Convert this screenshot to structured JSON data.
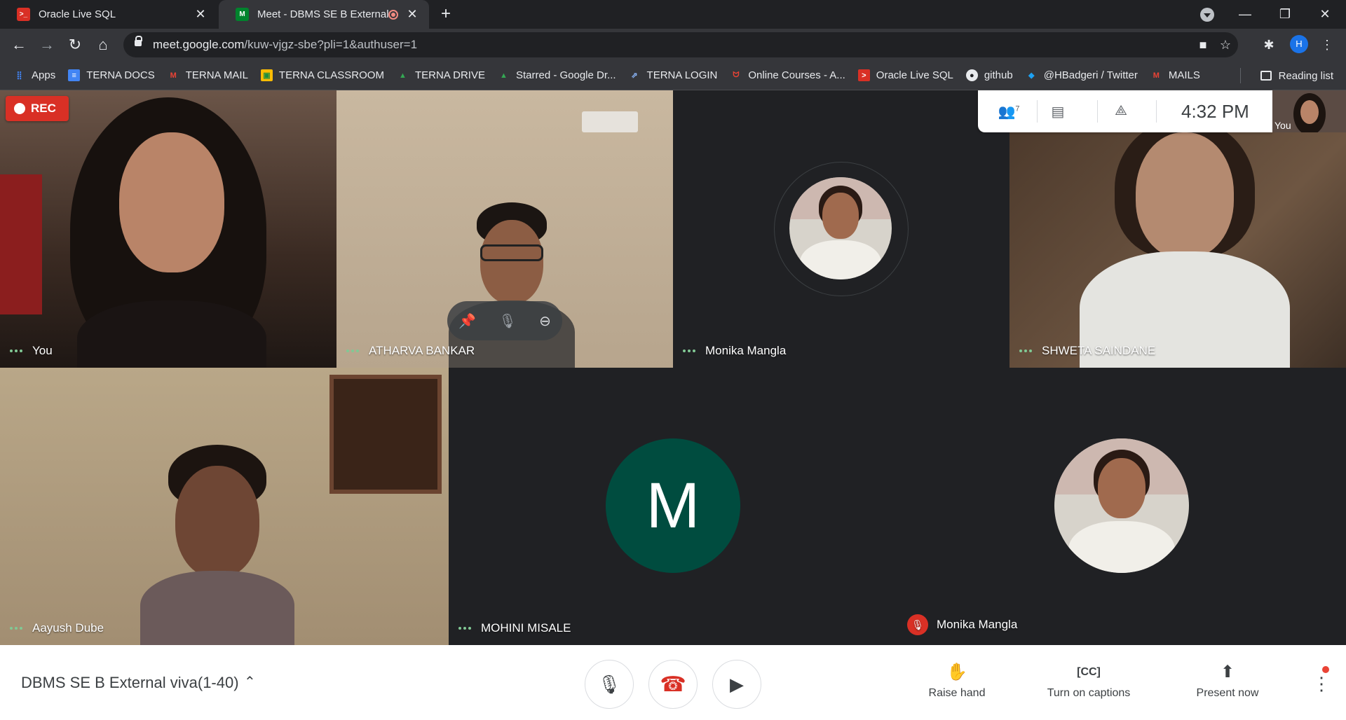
{
  "browser": {
    "tabs": [
      {
        "title": "Oracle Live SQL",
        "favicon": ">_",
        "favicon_color": "#d93025"
      },
      {
        "title": "Meet - DBMS SE B External v",
        "favicon": "M",
        "favicon_color": "#00832d",
        "active": true
      }
    ],
    "url_host": "meet.google.com",
    "url_path": "/kuw-vjgz-sbe?pli=1&authuser=1",
    "profile_initial": "H",
    "bookmarks": [
      {
        "label": "Apps",
        "icon": "apps-grid-icon",
        "color": "#4285f4"
      },
      {
        "label": "TERNA DOCS",
        "icon": "docs-icon",
        "color": "#4285f4"
      },
      {
        "label": "TERNA MAIL",
        "icon": "gmail-icon",
        "color": "#ea4335"
      },
      {
        "label": "TERNA CLASSROOM",
        "icon": "classroom-icon",
        "color": "#fbbc04"
      },
      {
        "label": "TERNA DRIVE",
        "icon": "drive-icon",
        "color": "#34a853"
      },
      {
        "label": "Starred - Google Dr...",
        "icon": "drive-icon",
        "color": "#34a853"
      },
      {
        "label": "TERNA LOGIN",
        "icon": "external-link-icon",
        "color": "#8ab4f8"
      },
      {
        "label": "Online Courses - A...",
        "icon": "courses-icon",
        "color": "#ea4335"
      },
      {
        "label": "Oracle Live SQL",
        "icon": "oracle-icon",
        "color": "#d93025"
      },
      {
        "label": "github",
        "icon": "github-icon",
        "color": "#e8eaed"
      },
      {
        "label": "@HBadgeri / Twitter",
        "icon": "twitter-icon",
        "color": "#1da1f2"
      },
      {
        "label": "MAILS",
        "icon": "gmail-icon",
        "color": "#ea4335"
      }
    ],
    "reading_list": "Reading list"
  },
  "meet": {
    "rec_label": "REC",
    "participants": [
      {
        "name": "You"
      },
      {
        "name": "ATHARVA BANKAR"
      },
      {
        "name": "Monika Mangla"
      },
      {
        "name": "SHWETA SAINDANE"
      },
      {
        "name": "Aayush Dube"
      },
      {
        "name": "MOHINI MISALE",
        "avatar_letter": "M"
      },
      {
        "name": "Monika Mangla",
        "muted": true
      }
    ],
    "participant_count": "7",
    "clock": "4:32  PM",
    "self_view_label": "You"
  },
  "bottom": {
    "meeting_title": "DBMS SE B External viva(1-40)",
    "raise_hand": "Raise hand",
    "captions": "Turn on captions",
    "present": "Present now"
  }
}
